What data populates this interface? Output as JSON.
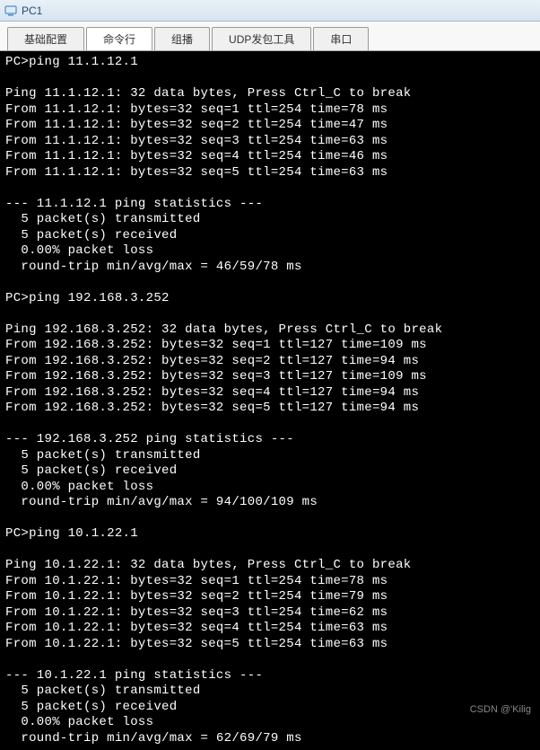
{
  "window": {
    "title": "PC1"
  },
  "tabs": {
    "items": [
      {
        "label": "基础配置"
      },
      {
        "label": "命令行"
      },
      {
        "label": "组播"
      },
      {
        "label": "UDP发包工具"
      },
      {
        "label": "串口"
      }
    ],
    "active_index": 1
  },
  "terminal": {
    "lines": [
      "PC>ping 11.1.12.1",
      "",
      "Ping 11.1.12.1: 32 data bytes, Press Ctrl_C to break",
      "From 11.1.12.1: bytes=32 seq=1 ttl=254 time=78 ms",
      "From 11.1.12.1: bytes=32 seq=2 ttl=254 time=47 ms",
      "From 11.1.12.1: bytes=32 seq=3 ttl=254 time=63 ms",
      "From 11.1.12.1: bytes=32 seq=4 ttl=254 time=46 ms",
      "From 11.1.12.1: bytes=32 seq=5 ttl=254 time=63 ms",
      "",
      "--- 11.1.12.1 ping statistics ---",
      "  5 packet(s) transmitted",
      "  5 packet(s) received",
      "  0.00% packet loss",
      "  round-trip min/avg/max = 46/59/78 ms",
      "",
      "PC>ping 192.168.3.252",
      "",
      "Ping 192.168.3.252: 32 data bytes, Press Ctrl_C to break",
      "From 192.168.3.252: bytes=32 seq=1 ttl=127 time=109 ms",
      "From 192.168.3.252: bytes=32 seq=2 ttl=127 time=94 ms",
      "From 192.168.3.252: bytes=32 seq=3 ttl=127 time=109 ms",
      "From 192.168.3.252: bytes=32 seq=4 ttl=127 time=94 ms",
      "From 192.168.3.252: bytes=32 seq=5 ttl=127 time=94 ms",
      "",
      "--- 192.168.3.252 ping statistics ---",
      "  5 packet(s) transmitted",
      "  5 packet(s) received",
      "  0.00% packet loss",
      "  round-trip min/avg/max = 94/100/109 ms",
      "",
      "PC>ping 10.1.22.1",
      "",
      "Ping 10.1.22.1: 32 data bytes, Press Ctrl_C to break",
      "From 10.1.22.1: bytes=32 seq=1 ttl=254 time=78 ms",
      "From 10.1.22.1: bytes=32 seq=2 ttl=254 time=79 ms",
      "From 10.1.22.1: bytes=32 seq=3 ttl=254 time=62 ms",
      "From 10.1.22.1: bytes=32 seq=4 ttl=254 time=63 ms",
      "From 10.1.22.1: bytes=32 seq=5 ttl=254 time=63 ms",
      "",
      "--- 10.1.22.1 ping statistics ---",
      "  5 packet(s) transmitted",
      "  5 packet(s) received",
      "  0.00% packet loss",
      "  round-trip min/avg/max = 62/69/79 ms"
    ]
  },
  "watermark": {
    "text": "CSDN @'Kilig"
  }
}
